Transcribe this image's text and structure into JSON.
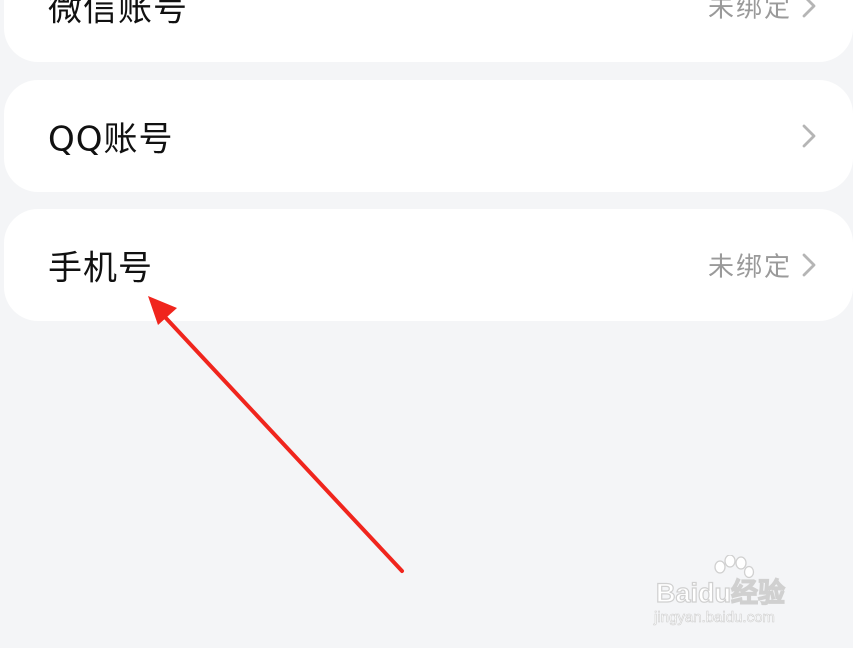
{
  "accounts": [
    {
      "label": "微信账号",
      "status": "未绑定"
    },
    {
      "label": "QQ账号",
      "status": ""
    },
    {
      "label": "手机号",
      "status": "未绑定"
    }
  ],
  "icons": {
    "chevron": "chevron-right-icon",
    "annotation": "red-arrow-annotation"
  },
  "colors": {
    "background": "#f4f5f7",
    "card": "#ffffff",
    "label": "#111111",
    "status": "#9a9a9a",
    "chevron": "#b5b5b5",
    "annotation_arrow": "#f0251d"
  },
  "watermark": {
    "brand_left": "Bai",
    "brand_mid": "du",
    "brand_right": "经验",
    "url": "jingyan.baidu.com"
  }
}
